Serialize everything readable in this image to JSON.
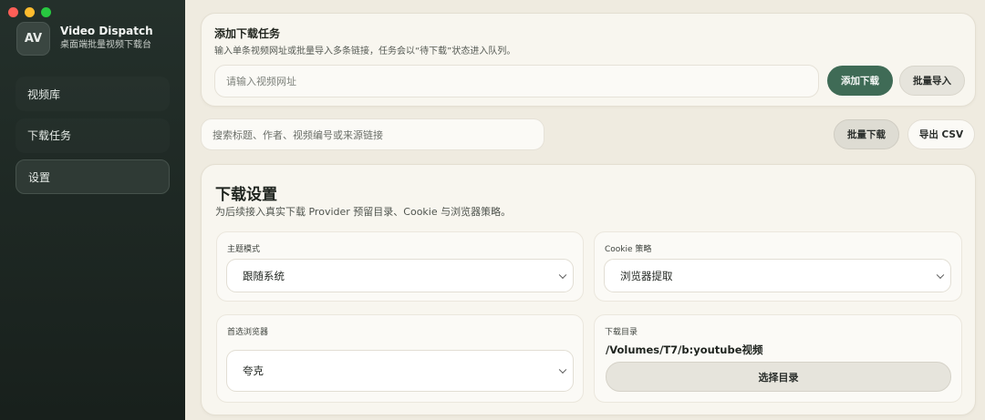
{
  "app": {
    "avatar": "AV",
    "title": "Video Dispatch",
    "subtitle": "桌面端批量视频下载台"
  },
  "sidebar": {
    "items": [
      {
        "label": "视频库",
        "active": false
      },
      {
        "label": "下载任务",
        "active": false
      },
      {
        "label": "设置",
        "active": true
      }
    ]
  },
  "add_task": {
    "title": "添加下载任务",
    "description": "输入单条视频网址或批量导入多条链接，任务会以“待下载”状态进入队列。",
    "url_placeholder": "请输入视频网址",
    "add_button": "添加下载",
    "import_button": "批量导入"
  },
  "toolbar": {
    "search_placeholder": "搜索标题、作者、视频编号或来源链接",
    "bulk_download_button": "批量下载",
    "export_button": "导出 CSV"
  },
  "settings": {
    "title": "下载设置",
    "description": "为后续接入真实下载 Provider 预留目录、Cookie 与浏览器策略。",
    "theme_label": "主题模式",
    "theme_value": "跟随系统",
    "cookie_label": "Cookie 策略",
    "cookie_value": "浏览器提取",
    "browser_label": "首选浏览器",
    "browser_value": "夸克",
    "dir_label": "下载目录",
    "dir_value": "/Volumes/T7/b:youtube视频",
    "choose_dir_button": "选择目录"
  },
  "colors": {
    "sidebar_bg": "#1f2925",
    "main_bg": "#efebe0",
    "primary": "#3f6b56"
  }
}
